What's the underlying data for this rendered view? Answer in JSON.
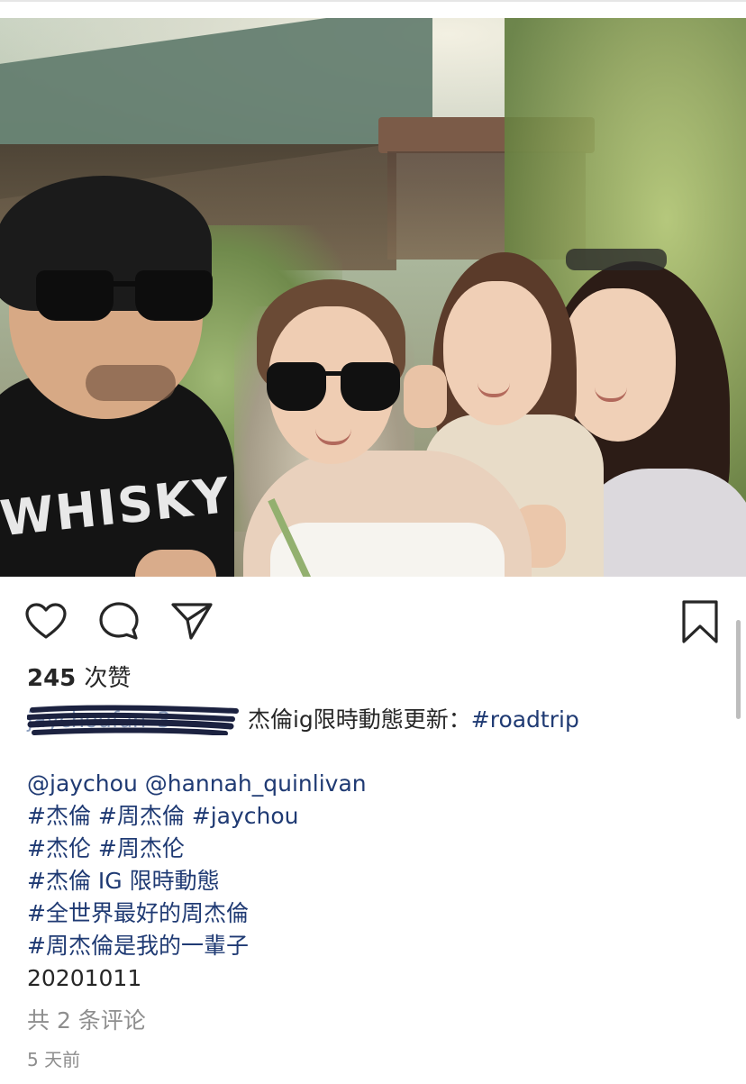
{
  "post": {
    "likes_count": "245",
    "likes_suffix": "次赞",
    "caption": {
      "username_redacted": "jaychoufan_3",
      "username_tail": "3",
      "text": " 杰倫ig限時動態更新：",
      "hashtag": "#roadtrip"
    },
    "body_lines": [
      "@jaychou @hannah_quinlivan",
      "#杰倫 #周杰倫 #jaychou",
      "#杰伦 #周杰伦",
      "#杰倫 IG 限時動態",
      "#全世界最好的周杰倫",
      "#周杰倫是我的一輩子"
    ],
    "date_line": "20201011",
    "comments_link": "共 2 条评论",
    "time_ago": "5 天前",
    "photo_shirt_text": "WHISKY"
  },
  "icons": {
    "like": "heart-icon",
    "comment": "comment-bubble-icon",
    "share": "paper-plane-icon",
    "save": "bookmark-icon"
  },
  "colors": {
    "hashtag": "#1f3a73",
    "muted": "#8e8e8e",
    "text": "#262626",
    "redaction": "#1c2240"
  }
}
